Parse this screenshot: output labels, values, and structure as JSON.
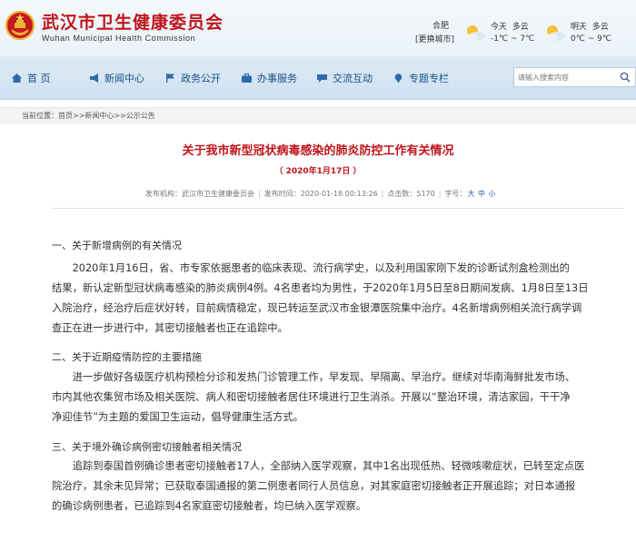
{
  "header": {
    "title": "武汉市卫生健康委员会",
    "subtitle": "Wuhan Municipal Health Commission",
    "city": "合肥",
    "city_switch": "[更换城市]",
    "weather": [
      {
        "day_label": "今天",
        "condition": "多云",
        "temp": "-1℃ ~ 7℃",
        "icon": "partly-cloudy-icon"
      },
      {
        "day_label": "明天",
        "condition": "多云",
        "temp": "0℃ ~ 9℃",
        "icon": "partly-cloudy-icon"
      }
    ]
  },
  "nav": {
    "items": [
      {
        "label": "首 页",
        "icon": "home-icon"
      },
      {
        "label": "新闻中心",
        "icon": "megaphone-icon"
      },
      {
        "label": "政务公开",
        "icon": "flag-icon"
      },
      {
        "label": "办事服务",
        "icon": "briefcase-icon"
      },
      {
        "label": "交流互动",
        "icon": "chat-icon"
      },
      {
        "label": "专题专栏",
        "icon": "pin-icon"
      }
    ],
    "search_placeholder": "请输入搜索内容"
  },
  "breadcrumb": {
    "text": "当前位置：首页>>新闻中心>>公示公告"
  },
  "article": {
    "title": "关于我市新型冠状病毒感染的肺炎防控工作有关情况",
    "date": "（ 2020年1月17日 ）",
    "meta": {
      "publisher": "发布机构：武汉市卫生健康委员会",
      "time": "发布时间：2020-01-18 00:13:26",
      "clicks": "点击数：5170",
      "font_label": "字号：",
      "sizes": [
        "大",
        "中",
        "小"
      ]
    },
    "sections": [
      {
        "heading": "一、关于新增病例的有关情况",
        "lines": [
          "　　2020年1月16日，省、市专家依据患者的临床表现、流行病学史，以及利用国家刚下发的诊断试剂盒检测出的",
          "结果，新认定新型冠状病毒感染的肺炎病例4例。4名患者均为男性，于2020年1月5日至8日期间发病、1月8日至13日",
          "入院治疗，经治疗后症状好转，目前病情稳定，现已转运至武汉市金银潭医院集中治疗。4名新增病例相关流行病学调",
          "查正在进一步进行中，其密切接触者也正在追踪中。"
        ]
      },
      {
        "heading": "二、关于近期疫情防控的主要措施",
        "lines": [
          "　　进一步做好各级医疗机构预检分诊和发热门诊管理工作，早发现、早隔离、早治疗。继续对华南海鲜批发市场、",
          "市内其他农集贸市场及相关医院、病人和密切接触者居住环境进行卫生消杀。开展以“整治环境，清洁家园，干干净",
          "净迎佳节”为主题的爱国卫生运动，倡导健康生活方式。"
        ]
      },
      {
        "heading": "三、关于境外确诊病例密切接触者相关情况",
        "lines": [
          "　　追踪到泰国首例确诊患者密切接触者17人，全部纳入医学观察，其中1名出现低热、轻微咳嗽症状，已转至定点医",
          "院治疗，其余未见异常；已获取泰国通报的第二例患者同行人员信息，对其家庭密切接触者正开展追踪；对日本通报",
          "的确诊病例患者，已追踪到4名家庭密切接触者，均已纳入医学观察。"
        ]
      }
    ]
  },
  "colors": {
    "brand_red": "#c0141b",
    "nav_text": "#1a4f86",
    "nav_bg": "#d6e6f3",
    "link_blue": "#2a5aa8"
  }
}
